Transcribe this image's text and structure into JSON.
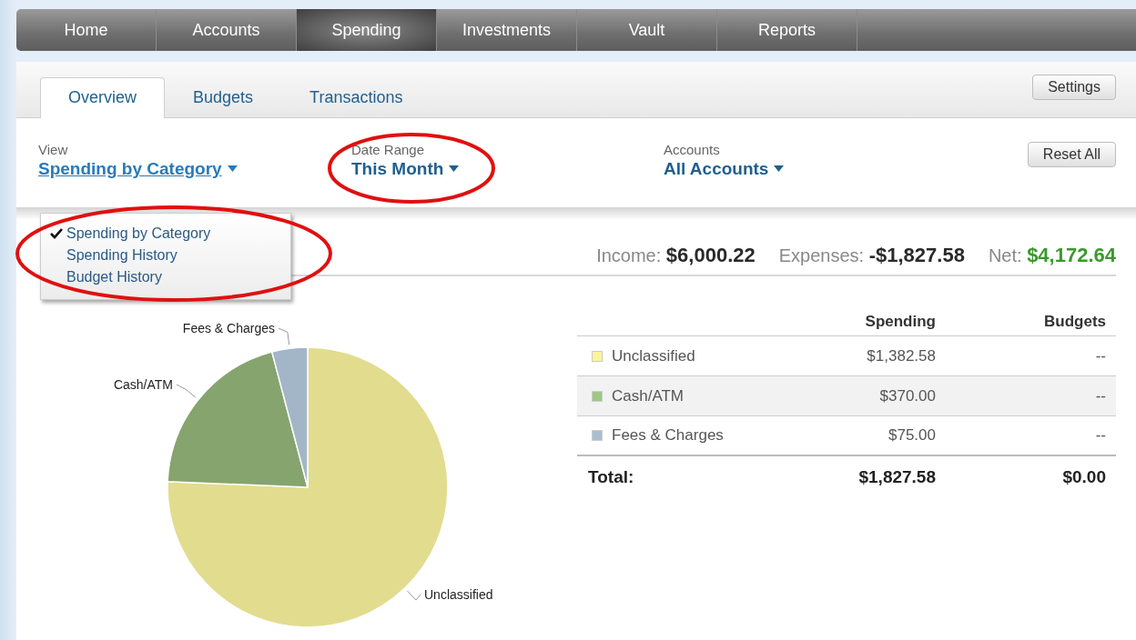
{
  "main_nav": [
    {
      "label": "Home",
      "selected": false
    },
    {
      "label": "Accounts",
      "selected": false
    },
    {
      "label": "Spending",
      "selected": true
    },
    {
      "label": "Investments",
      "selected": false
    },
    {
      "label": "Vault",
      "selected": false
    },
    {
      "label": "Reports",
      "selected": false
    }
  ],
  "sub_tabs": [
    {
      "label": "Overview",
      "selected": true
    },
    {
      "label": "Budgets",
      "selected": false
    },
    {
      "label": "Transactions",
      "selected": false
    }
  ],
  "settings_button": "Settings",
  "filters": [
    {
      "label": "View",
      "value": "Spending by Category",
      "expanded": true
    },
    {
      "label": "Date Range",
      "value": "This Month",
      "expanded": false
    },
    {
      "label": "Accounts",
      "value": "All Accounts",
      "expanded": false
    }
  ],
  "reset_button": "Reset All",
  "view_menu": [
    {
      "label": "Spending by Category",
      "checked": true
    },
    {
      "label": "Spending History",
      "checked": false
    },
    {
      "label": "Budget History",
      "checked": false
    }
  ],
  "summary": [
    {
      "label": "Income:",
      "value": "$6,000.22",
      "kind": "neutral"
    },
    {
      "label": "Expenses:",
      "value": "-$1,827.58",
      "kind": "neutral"
    },
    {
      "label": "Net:",
      "value": "$4,172.64",
      "kind": "positive"
    }
  ],
  "chart_data": {
    "type": "pie",
    "categories": [
      "Unclassified",
      "Cash/ATM",
      "Fees & Charges"
    ],
    "series": [
      {
        "values": [
          75.65,
          20.25,
          4.1
        ]
      }
    ],
    "colors": [
      "#e2dc8e",
      "#86a46e",
      "#a3b6c8"
    ]
  },
  "table": {
    "columns": [
      "Spending",
      "Budgets"
    ],
    "rows": [
      {
        "name": "Unclassified",
        "color": "#fbf49a",
        "spending": "$1,382.58",
        "budget": "--"
      },
      {
        "name": "Cash/ATM",
        "color": "#9fc784",
        "spending": "$370.00",
        "budget": "--"
      },
      {
        "name": "Fees & Charges",
        "color": "#a8bfd3",
        "spending": "$75.00",
        "budget": "--"
      }
    ],
    "total": {
      "label": "Total:",
      "spending": "$1,827.58",
      "budget": "$0.00"
    }
  }
}
